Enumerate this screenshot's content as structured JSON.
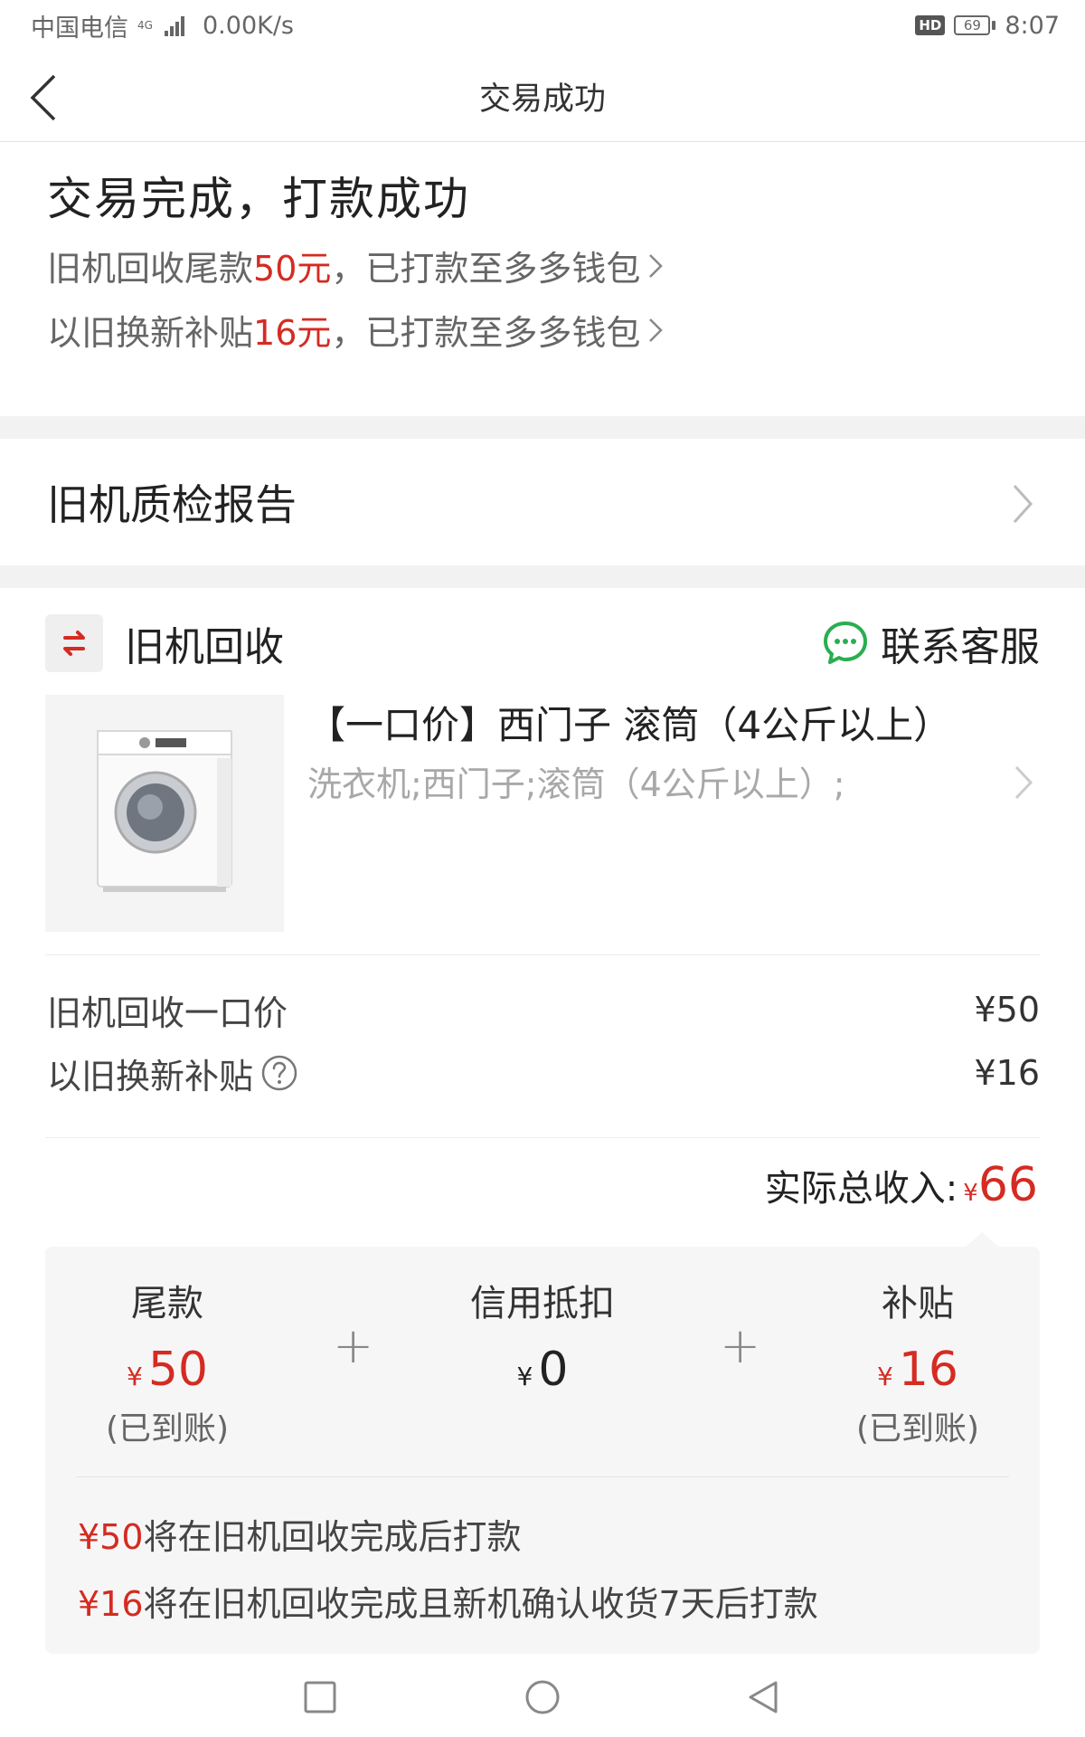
{
  "status_bar": {
    "carrier": "中国电信",
    "network": "4G",
    "speed": "0.00K/s",
    "hd": "HD",
    "battery": "69",
    "time": "8:07"
  },
  "nav": {
    "title": "交易成功",
    "icon": "back-chevron-icon"
  },
  "summary": {
    "title": "交易完成，打款成功",
    "line1": {
      "pre": "旧机回收尾款",
      "amount": "50元",
      "post": "，已打款至多多钱包"
    },
    "line2": {
      "pre": "以旧换新补贴",
      "amount": "16元",
      "post": "，已打款至多多钱包"
    }
  },
  "report": {
    "label": "旧机质检报告"
  },
  "recycle": {
    "label": "旧机回收",
    "service_label": "联系客服",
    "product_name": "【一口价】西门子 滚筒（4公斤以上）",
    "product_spec": "洗衣机;西门子;滚筒（4公斤以上）;",
    "rows": [
      {
        "label": "旧机回收一口价",
        "value": "¥50"
      },
      {
        "label": "以旧换新补贴",
        "value": "¥16"
      }
    ],
    "total_label": "实际总收入:",
    "total_yen": "¥",
    "total_value": "66"
  },
  "breakdown": {
    "plus": "+",
    "columns": [
      {
        "title": "尾款",
        "yen": "¥",
        "amount": "50",
        "note": "(已到账)"
      },
      {
        "title": "信用抵扣",
        "yen": "¥",
        "amount": "0",
        "note": ""
      },
      {
        "title": "补贴",
        "yen": "¥",
        "amount": "16",
        "note": "(已到账)"
      }
    ],
    "notes": [
      {
        "amount": "¥50",
        "text": "将在旧机回收完成后打款"
      },
      {
        "amount": "¥16",
        "text": "将在旧机回收完成且新机确认收货7天后打款"
      }
    ]
  },
  "colors": {
    "accent_red": "#d42b22",
    "chat_green": "#2aae4f",
    "background_gray": "#f2f2f2"
  }
}
